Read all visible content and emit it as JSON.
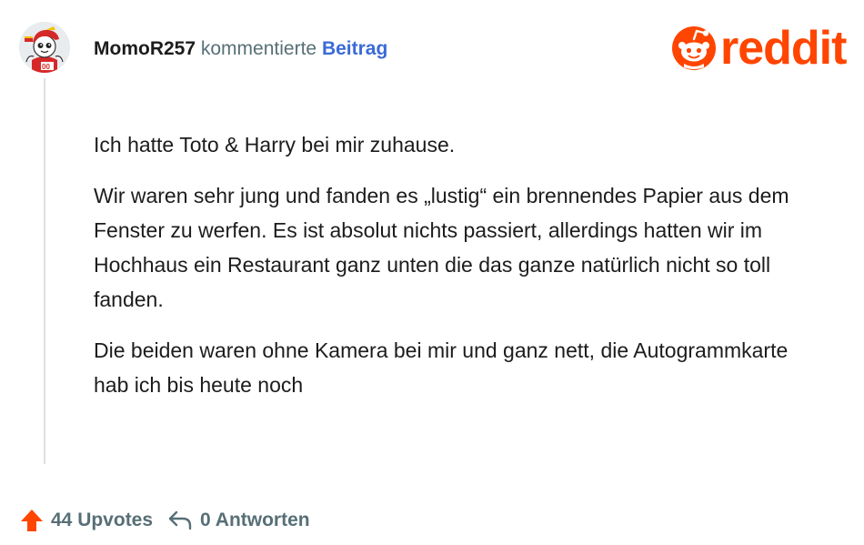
{
  "comment": {
    "username": "MomoR257",
    "action": "kommentierte",
    "post_link": "Beitrag",
    "paragraphs": [
      "Ich hatte Toto & Harry bei mir zuhause.",
      "Wir waren sehr jung und fanden es „lustig“ ein brennendes Papier aus dem Fenster zu werfen. Es ist absolut nichts passiert, allerdings hatten wir im Hochhaus ein Restaurant ganz unten die das ganze natürlich nicht so toll fanden.",
      "Die beiden waren ohne Kamera bei mir und ganz nett, die Autogrammkarte hab ich bis heute noch"
    ]
  },
  "brand": {
    "logo_text": "reddit",
    "color": "#ff4500"
  },
  "footer": {
    "upvotes": "44 Upvotes",
    "replies": "0 Antworten",
    "upvote_icon": "upvote-arrow-icon",
    "reply_icon": "reply-arrow-icon",
    "upvote_color": "#ff4500"
  }
}
